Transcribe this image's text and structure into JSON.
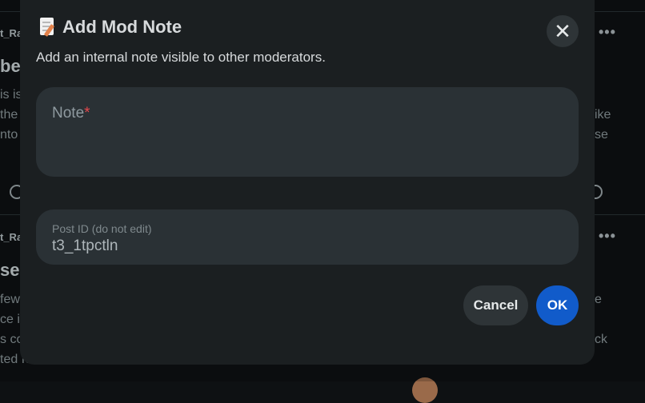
{
  "background": {
    "user1": "t_Ra",
    "title1": "be",
    "body1": [
      "is is",
      "the",
      "nto"
    ],
    "right1": [
      "ike",
      "se"
    ],
    "user2": "t_Ra",
    "title2": "se",
    "body2": [
      "few",
      "ce i",
      "s co",
      "ted fo"
    ],
    "right2": [
      "e",
      "ck"
    ],
    "menu_glyph": "•••"
  },
  "modal": {
    "title": "Add Mod Note",
    "title_icon": "memo-pencil-icon",
    "subtitle": "Add an internal note visible to other moderators.",
    "close_glyph": "✕",
    "note_field": {
      "label": "Note",
      "required_mark": "*",
      "value": ""
    },
    "post_field": {
      "label": "Post ID (do not edit)",
      "value": "t3_1tpctln"
    },
    "buttons": {
      "cancel": "Cancel",
      "ok": "OK"
    }
  },
  "colors": {
    "primary": "#115bca",
    "modal_bg": "#1b1f21",
    "field_bg": "#2a3135",
    "required": "#e5484d"
  }
}
